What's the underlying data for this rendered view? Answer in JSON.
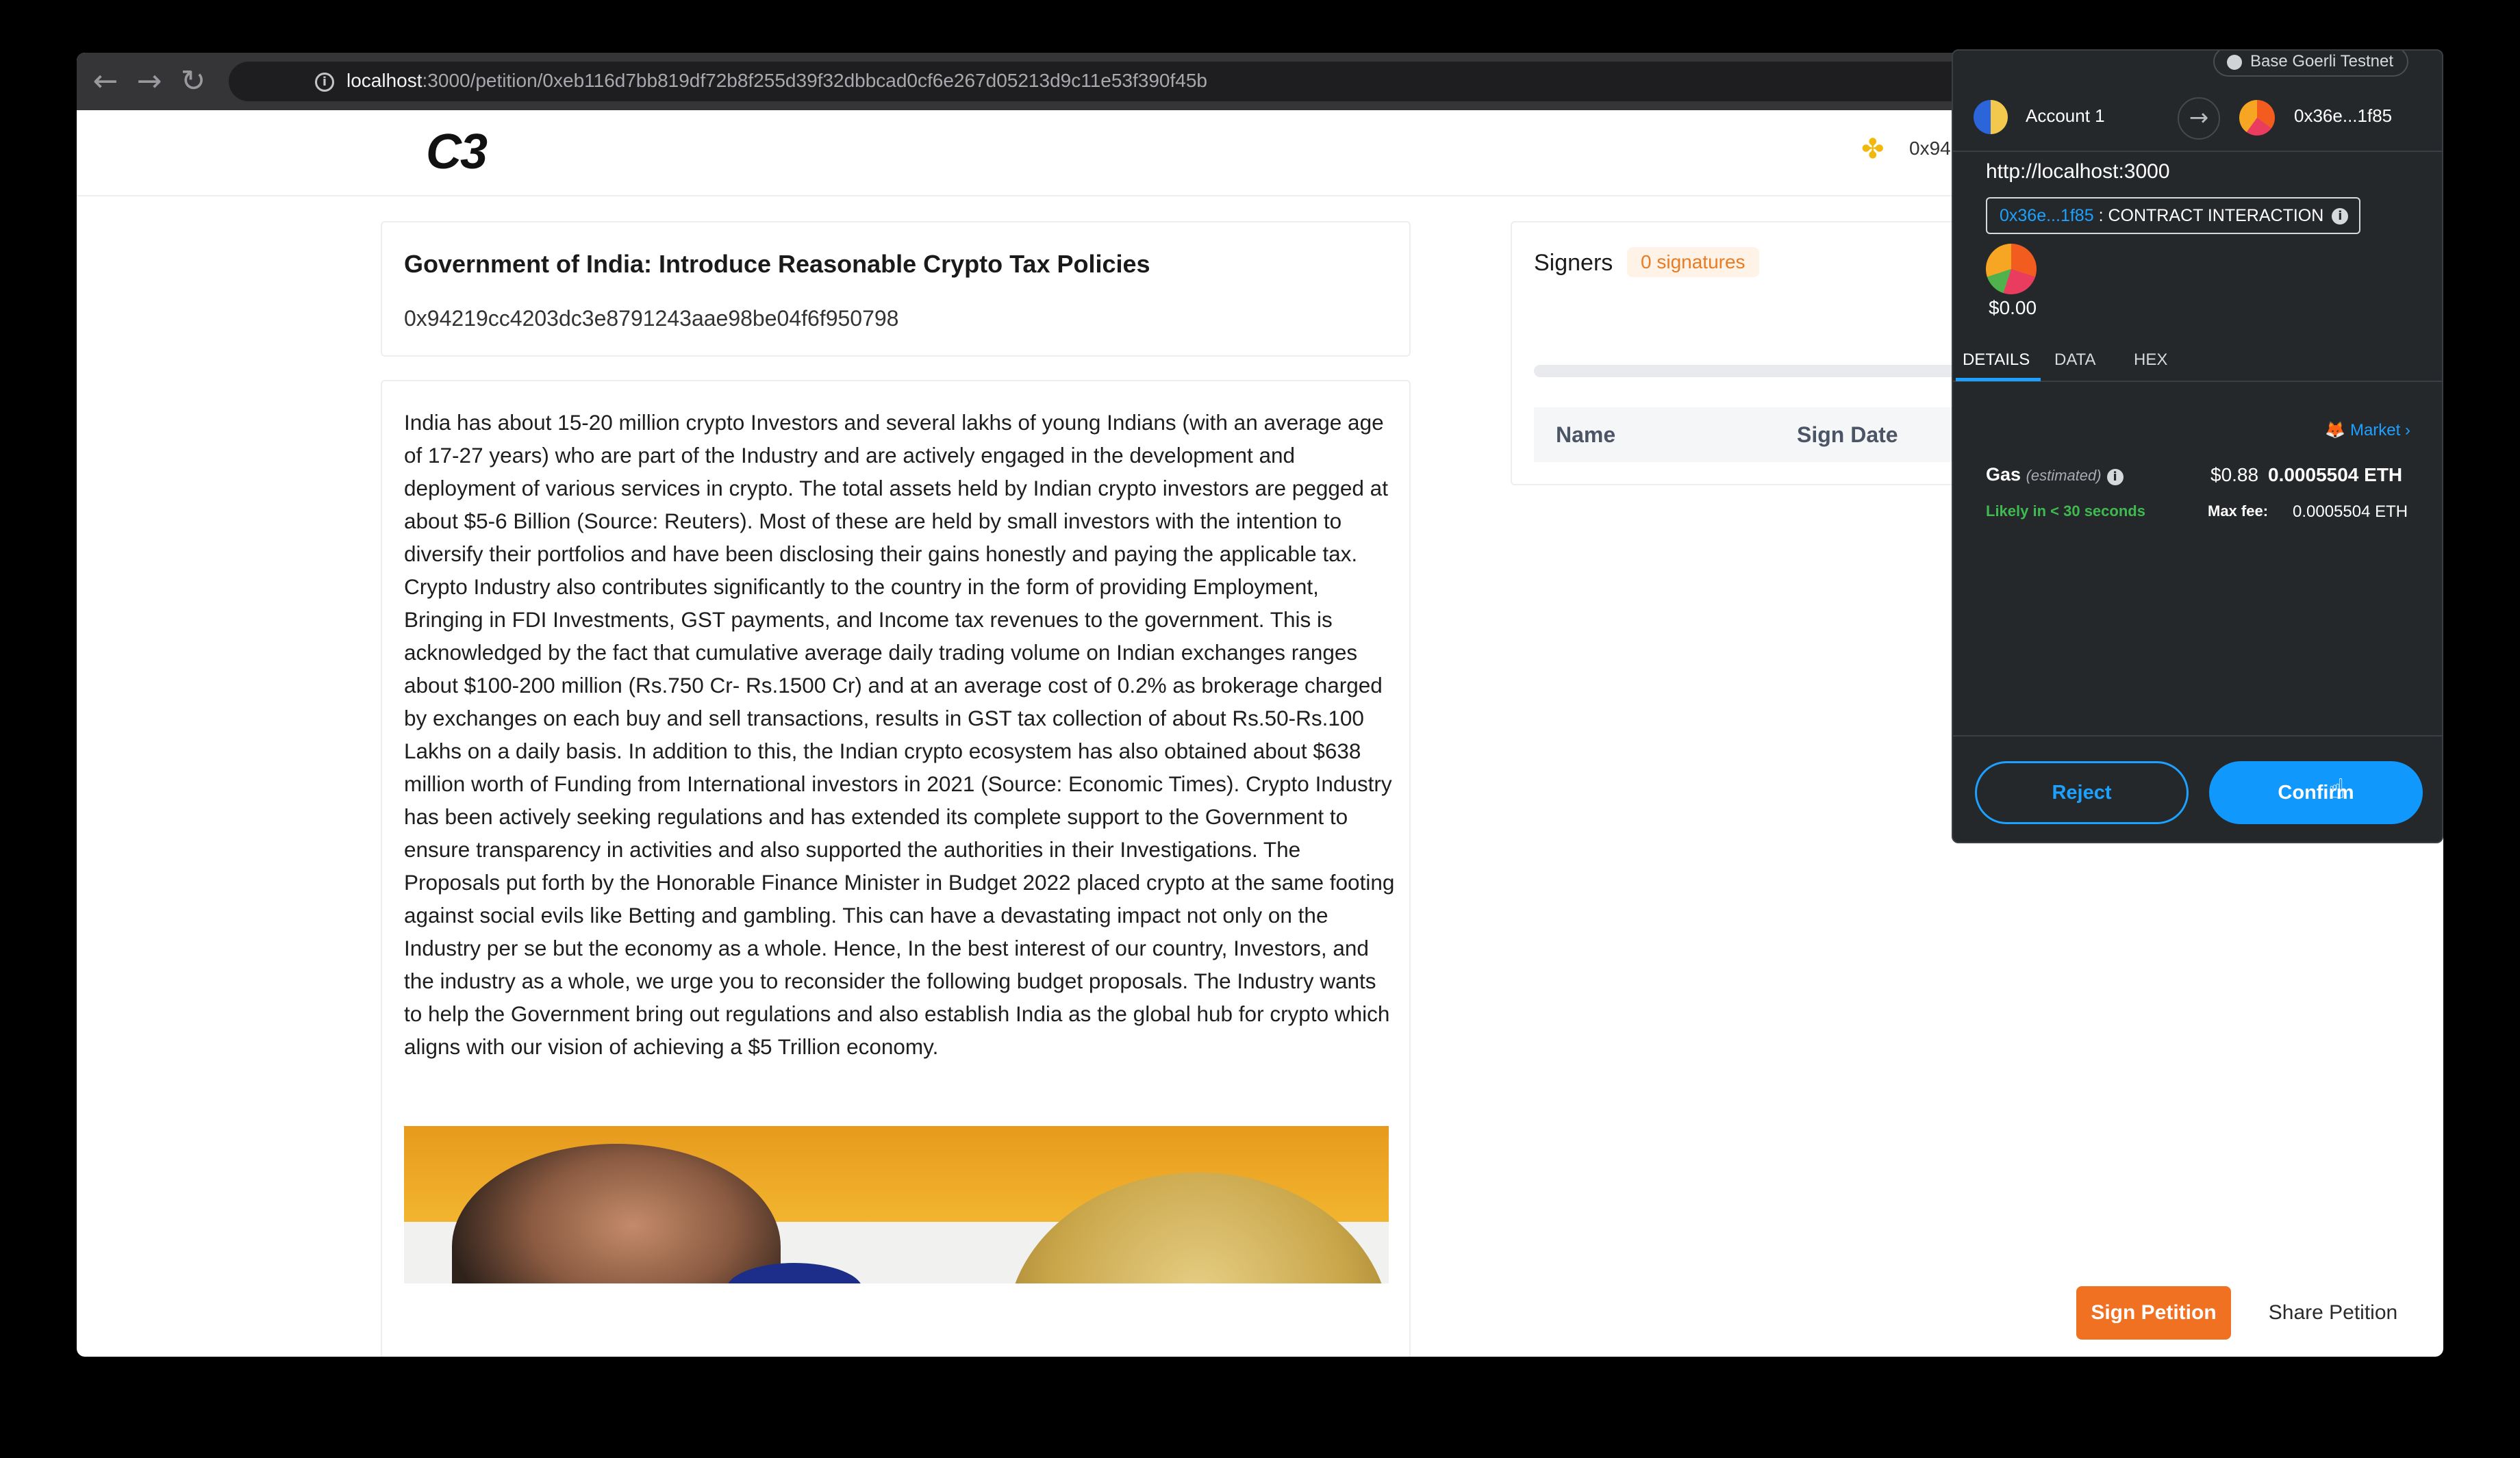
{
  "browser": {
    "url_host": "localhost",
    "url_path": ":3000/petition/0xeb116d7bb819df72b8f255d39f32dbbcad0cf6e267d05213d9c11e53f390f45b",
    "icons": [
      "back-arrow-icon",
      "forward-arrow-icon",
      "reload-icon",
      "site-info-icon",
      "share-icon"
    ]
  },
  "site": {
    "logo": "C3",
    "wallet_address_fragment": "0x94"
  },
  "petition": {
    "title": "Government of India: Introduce Reasonable Crypto Tax Policies",
    "address": "0x94219cc4203dc3e8791243aae98be04f6f950798",
    "body": "India has about 15-20 million crypto Investors and several lakhs of young Indians (with an average age of 17-27 years) who are part of the Industry and are actively engaged in the development and deployment of various services in crypto. The total assets held by Indian crypto investors are pegged at about $5-6 Billion (Source: Reuters). Most of these are held by small investors with the intention to diversify their portfolios and have been disclosing their gains honestly and paying the applicable tax. Crypto Industry also contributes significantly to the country in the form of providing Employment, Bringing in FDI Investments, GST payments, and Income tax revenues to the government. This is acknowledged by the fact that cumulative average daily trading volume on Indian exchanges ranges about $100-200 million (Rs.750 Cr- Rs.1500 Cr) and at an average cost of 0.2% as brokerage charged by exchanges on each buy and sell transactions, results in GST tax collection of about Rs.50-Rs.100 Lakhs on a daily basis. In addition to this, the Indian crypto ecosystem has also obtained about $638 million worth of Funding from International investors in 2021 (Source: Economic Times). Crypto Industry has been actively seeking regulations and has extended its complete support to the Government to ensure transparency in activities and also supported the authorities in their Investigations. The Proposals put forth by the Honorable Finance Minister in Budget 2022 placed crypto at the same footing against social evils like Betting and gambling. This can have a devastating impact not only on the Industry per se but the economy as a whole. Hence, In the best interest of our country, Investors, and the industry as a whole, we urge you to reconsider the following budget proposals. The Industry wants to help the Government bring out regulations and also establish India as the global hub for crypto which aligns with our vision of achieving a $5 Trillion economy."
  },
  "signers": {
    "title": "Signers",
    "badge": "0 signatures",
    "progress_fraction": 0,
    "columns": [
      "Name",
      "Sign Date"
    ]
  },
  "actions": {
    "sign": "Sign Petition",
    "share": "Share Petition"
  },
  "wallet_popup": {
    "network": "Base Goerli Testnet",
    "account_name": "Account 1",
    "to_address": "0x36e...1f85",
    "origin": "http://localhost:3000",
    "contract_address": "0x36e...1f85",
    "contract_label": " : CONTRACT INTERACTION",
    "value": "$0.00",
    "tabs": [
      "DETAILS",
      "DATA",
      "HEX"
    ],
    "active_tab": "DETAILS",
    "market_label": "Market",
    "gas_label": "Gas",
    "gas_sub": "(estimated)",
    "gas_usd": "$0.88",
    "gas_eth": "0.0005504 ETH",
    "likely": "Likely in < 30 seconds",
    "max_fee_label": "Max fee:",
    "max_fee_value": "0.0005504 ETH",
    "reject_label": "Reject",
    "confirm_label": "Confirm"
  },
  "colors": {
    "accent_orange": "#f07122",
    "wallet_bg": "#25282b",
    "wallet_blue": "#1098fc",
    "success_green": "#3fb950"
  }
}
